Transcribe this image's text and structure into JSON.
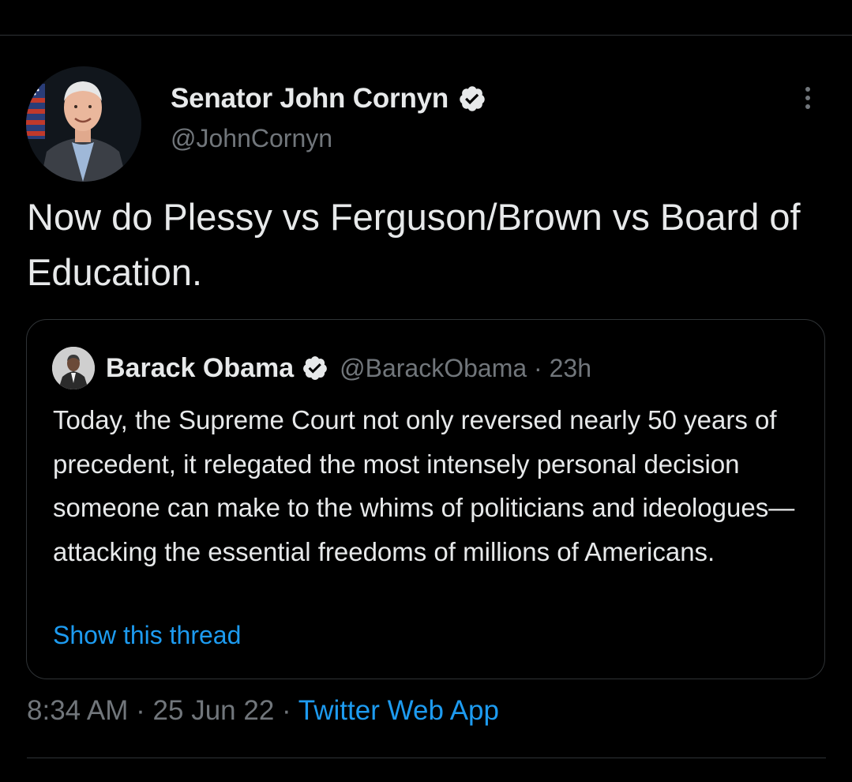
{
  "tweet": {
    "author": {
      "display_name": "Senator John Cornyn",
      "handle": "@JohnCornyn",
      "verified": true
    },
    "text": "Now do Plessy vs Ferguson/Brown vs Board of Education.",
    "quoted_tweet": {
      "author": {
        "display_name": "Barack Obama",
        "handle": "@BarackObama",
        "verified": true
      },
      "separator": "·",
      "age": "23h",
      "text": "Today, the Supreme Court not only reversed nearly 50 years of precedent, it relegated the most intensely personal decision someone can make to the whims of politicians and ideologues—attacking the essential freedoms of millions of Americans.",
      "thread_link_label": "Show this thread"
    },
    "time": "8:34 AM",
    "date": "25 Jun 22",
    "separator": "·",
    "source": "Twitter Web App"
  },
  "icons": {
    "verified": "verified-badge-icon",
    "more": "more-options-icon"
  },
  "colors": {
    "background": "#000000",
    "text_primary": "#e7e9ea",
    "text_secondary": "#71767b",
    "link": "#1d9bf0",
    "border": "#2f3336"
  }
}
